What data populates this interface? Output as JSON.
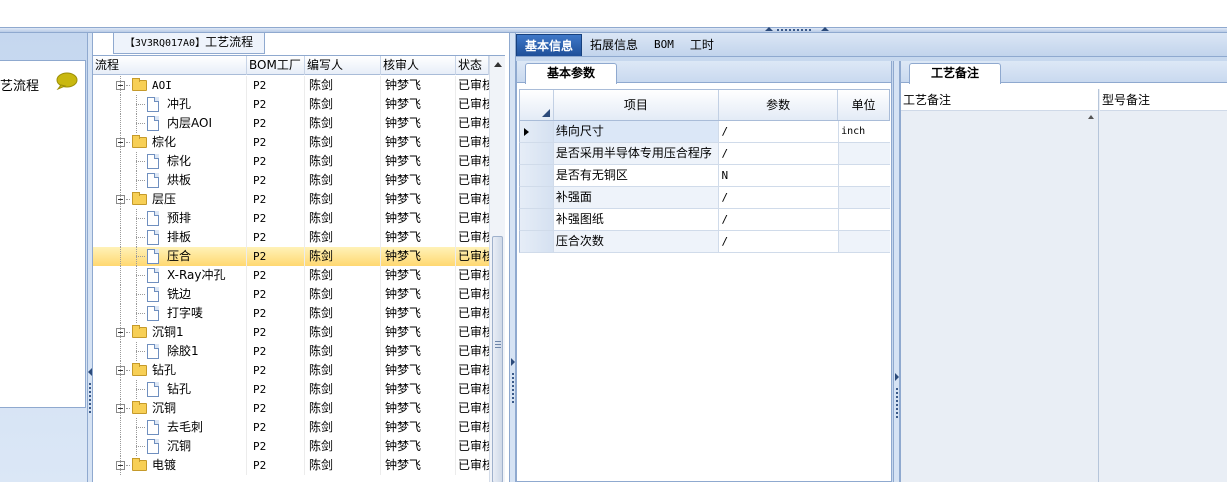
{
  "left_panel": {
    "label": "艺流程"
  },
  "tree_tab": {
    "code": "【3V3RQ017A0】",
    "title": "工艺流程"
  },
  "grid": {
    "columns": [
      "流程",
      "BOM工厂",
      "编写人",
      "核审人",
      "状态"
    ],
    "rows": [
      {
        "name": "AOI",
        "type": "folder",
        "level": 1,
        "factory": "P2",
        "writer": "陈剑",
        "reviewer": "钟梦飞",
        "status": "已审核"
      },
      {
        "name": "冲孔",
        "type": "doc",
        "level": 2,
        "factory": "P2",
        "writer": "陈剑",
        "reviewer": "钟梦飞",
        "status": "已审核"
      },
      {
        "name": "内层AOI",
        "type": "doc",
        "level": 2,
        "factory": "P2",
        "writer": "陈剑",
        "reviewer": "钟梦飞",
        "status": "已审核"
      },
      {
        "name": "棕化",
        "type": "folder",
        "level": 1,
        "factory": "P2",
        "writer": "陈剑",
        "reviewer": "钟梦飞",
        "status": "已审核"
      },
      {
        "name": "棕化",
        "type": "doc",
        "level": 2,
        "factory": "P2",
        "writer": "陈剑",
        "reviewer": "钟梦飞",
        "status": "已审核"
      },
      {
        "name": "烘板",
        "type": "doc",
        "level": 2,
        "factory": "P2",
        "writer": "陈剑",
        "reviewer": "钟梦飞",
        "status": "已审核"
      },
      {
        "name": "层压",
        "type": "folder",
        "level": 1,
        "factory": "P2",
        "writer": "陈剑",
        "reviewer": "钟梦飞",
        "status": "已审核"
      },
      {
        "name": "预排",
        "type": "doc",
        "level": 2,
        "factory": "P2",
        "writer": "陈剑",
        "reviewer": "钟梦飞",
        "status": "已审核"
      },
      {
        "name": "排板",
        "type": "doc",
        "level": 2,
        "factory": "P2",
        "writer": "陈剑",
        "reviewer": "钟梦飞",
        "status": "已审核"
      },
      {
        "name": "压合",
        "type": "doc",
        "level": 2,
        "factory": "P2",
        "writer": "陈剑",
        "reviewer": "钟梦飞",
        "status": "已审核",
        "selected": true
      },
      {
        "name": "X-Ray冲孔",
        "type": "doc",
        "level": 2,
        "factory": "P2",
        "writer": "陈剑",
        "reviewer": "钟梦飞",
        "status": "已审核"
      },
      {
        "name": "铣边",
        "type": "doc",
        "level": 2,
        "factory": "P2",
        "writer": "陈剑",
        "reviewer": "钟梦飞",
        "status": "已审核"
      },
      {
        "name": "打字唛",
        "type": "doc",
        "level": 2,
        "factory": "P2",
        "writer": "陈剑",
        "reviewer": "钟梦飞",
        "status": "已审核"
      },
      {
        "name": "沉铜1",
        "type": "folder",
        "level": 1,
        "factory": "P2",
        "writer": "陈剑",
        "reviewer": "钟梦飞",
        "status": "已审核"
      },
      {
        "name": "除胶1",
        "type": "doc",
        "level": 2,
        "factory": "P2",
        "writer": "陈剑",
        "reviewer": "钟梦飞",
        "status": "已审核"
      },
      {
        "name": "钻孔",
        "type": "folder",
        "level": 1,
        "factory": "P2",
        "writer": "陈剑",
        "reviewer": "钟梦飞",
        "status": "已审核"
      },
      {
        "name": "钻孔",
        "type": "doc",
        "level": 2,
        "factory": "P2",
        "writer": "陈剑",
        "reviewer": "钟梦飞",
        "status": "已审核"
      },
      {
        "name": "沉铜",
        "type": "folder",
        "level": 1,
        "factory": "P2",
        "writer": "陈剑",
        "reviewer": "钟梦飞",
        "status": "已审核"
      },
      {
        "name": "去毛刺",
        "type": "doc",
        "level": 2,
        "factory": "P2",
        "writer": "陈剑",
        "reviewer": "钟梦飞",
        "status": "已审核"
      },
      {
        "name": "沉铜",
        "type": "doc",
        "level": 2,
        "factory": "P2",
        "writer": "陈剑",
        "reviewer": "钟梦飞",
        "status": "已审核"
      },
      {
        "name": "电镀",
        "type": "folder",
        "level": 1,
        "factory": "P2",
        "writer": "陈剑",
        "reviewer": "钟梦飞",
        "status": "已审核"
      }
    ]
  },
  "main_tabs": [
    {
      "label": "基本信息",
      "active": true
    },
    {
      "label": "拓展信息",
      "active": false
    },
    {
      "label": "BOM",
      "active": false
    },
    {
      "label": "工时",
      "active": false
    }
  ],
  "basic_params": {
    "tab_label": "基本参数",
    "columns": {
      "item": "项目",
      "param": "参数",
      "unit": "单位"
    },
    "rows": [
      {
        "item": "纬向尺寸",
        "param": "/",
        "unit": "inch"
      },
      {
        "item": "是否采用半导体专用压合程序",
        "param": "/",
        "unit": ""
      },
      {
        "item": "是否有无铜区",
        "param": "N",
        "unit": ""
      },
      {
        "item": "补强面",
        "param": "/",
        "unit": ""
      },
      {
        "item": "补强图纸",
        "param": "/",
        "unit": ""
      },
      {
        "item": "压合次数",
        "param": "/",
        "unit": ""
      }
    ]
  },
  "remarks": {
    "tab_label": "工艺备注",
    "col1": "工艺备注",
    "col2": "型号备注"
  },
  "icons": {
    "chat": "speech-bubble-icon",
    "folder": "folder-icon",
    "doc": "document-icon"
  },
  "colors": {
    "selected_row": "#ffd871",
    "active_tab": "#1f4f99",
    "border": "#8fa9cf"
  }
}
